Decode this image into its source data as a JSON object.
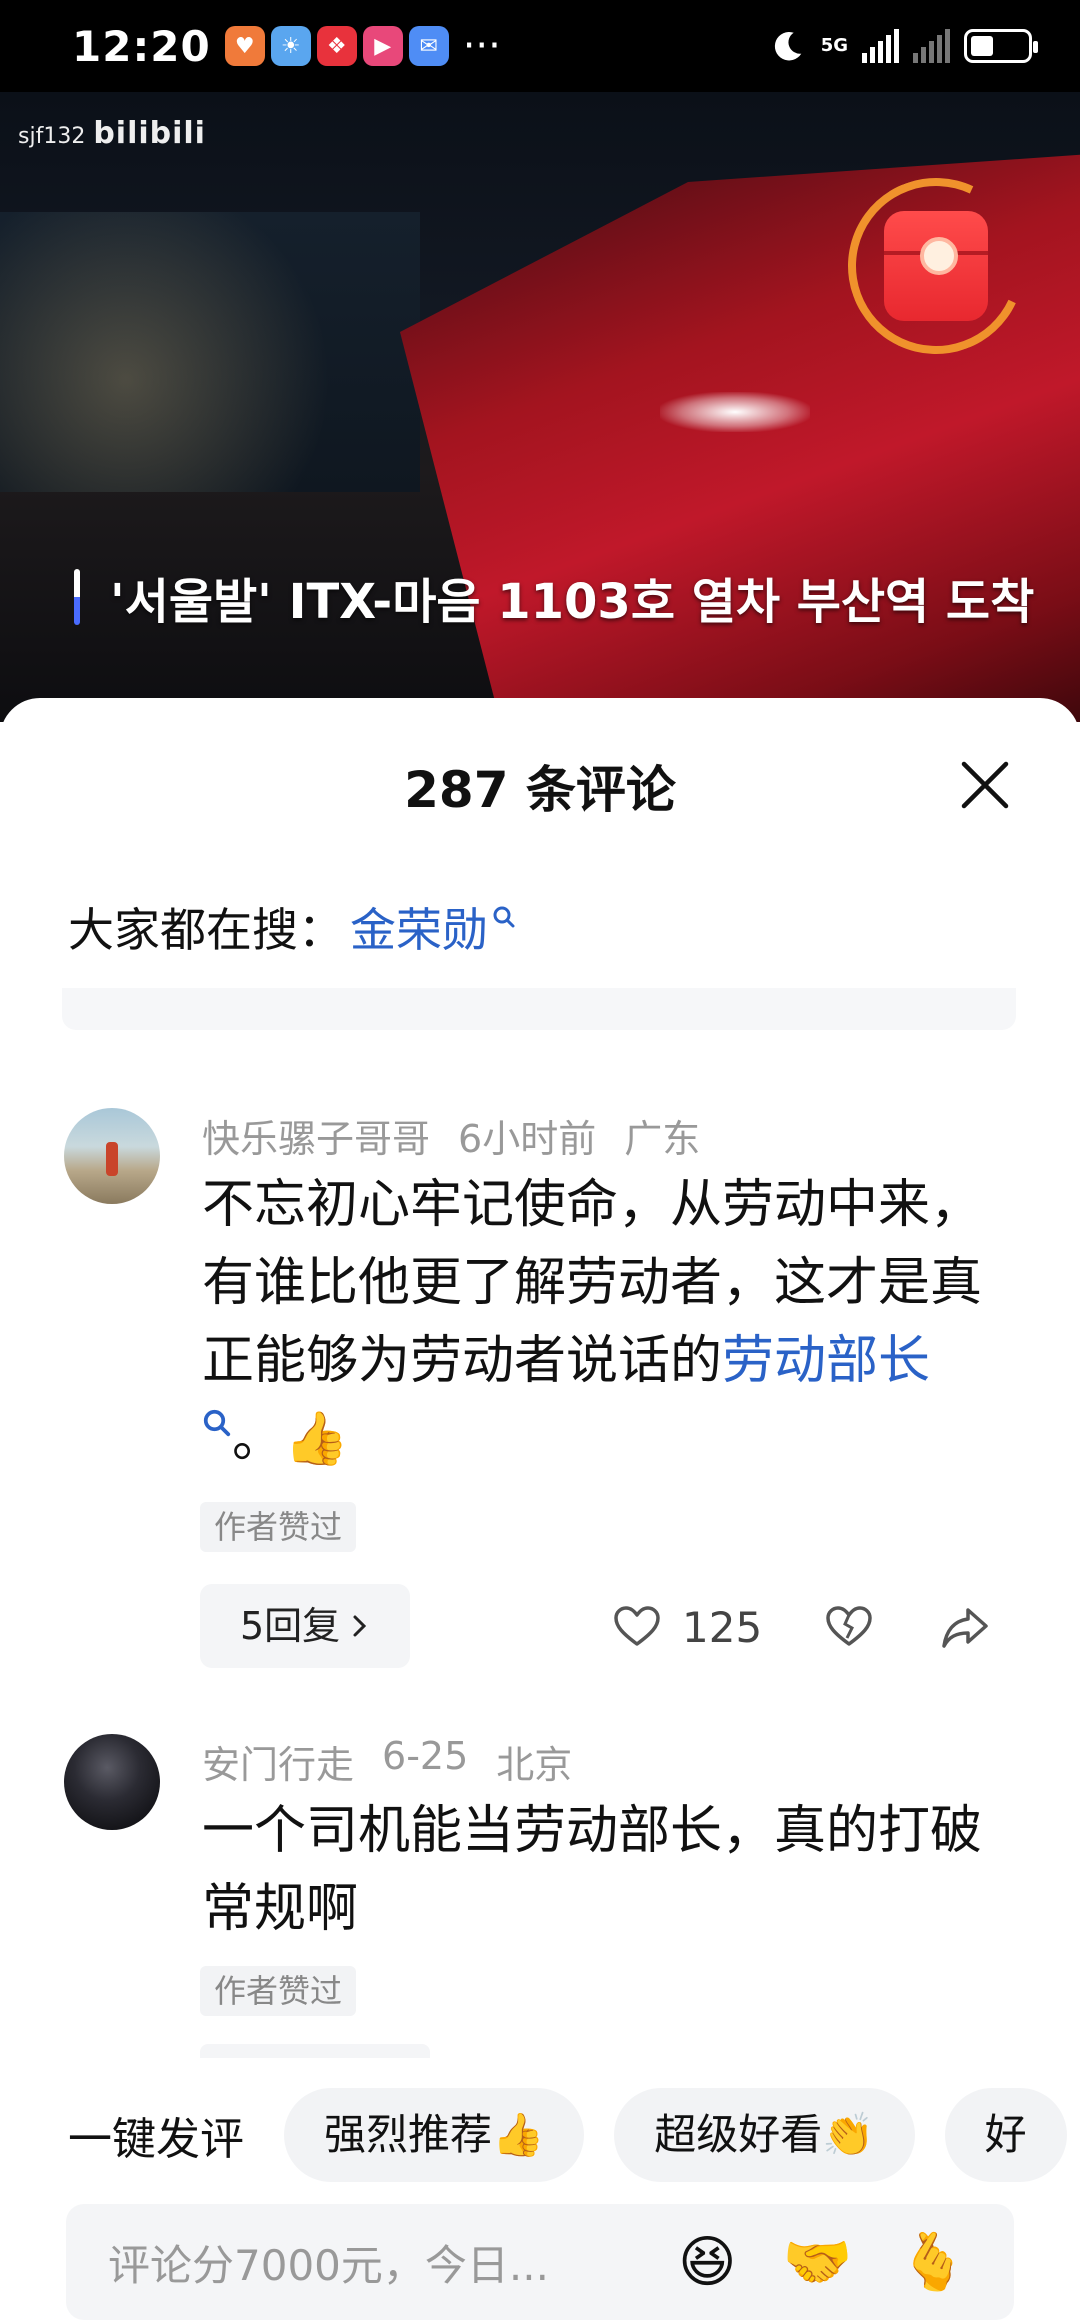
{
  "status_bar": {
    "time": "12:20",
    "network": "5G",
    "more": "···"
  },
  "video": {
    "watermark_user": "sjf132",
    "watermark_logo": "bilibili",
    "caption": "'서울발' ITX-마음 1103호 열차 부산역 도착"
  },
  "comments_panel": {
    "title": "287 条评论",
    "search_prefix": "大家都在搜：",
    "search_link": "金荣勋",
    "comments": [
      {
        "username": "快乐骡子哥哥",
        "time": "6小时前",
        "location": "广东",
        "text_before": "不忘初心牢记使命，从劳动中来，有谁比他更了解劳动者，这才是真正能够为劳动者说话的",
        "highlight": "劳动部长",
        "text_after": "。👍",
        "badge": "作者赞过",
        "replies": "5回复",
        "likes": "125"
      },
      {
        "username": "安门行走",
        "time": "6-25",
        "location": "北京",
        "text": "一个司机能当劳动部长，真的打破常规啊",
        "badge": "作者赞过"
      }
    ]
  },
  "quick_comment": {
    "label": "一键发评",
    "chips": [
      "强烈推荐👍",
      "超级好看👏",
      "好"
    ]
  },
  "input": {
    "placeholder": "评论分7000元，今日...",
    "emojis": [
      "😆",
      "🤝",
      "🫰"
    ]
  }
}
